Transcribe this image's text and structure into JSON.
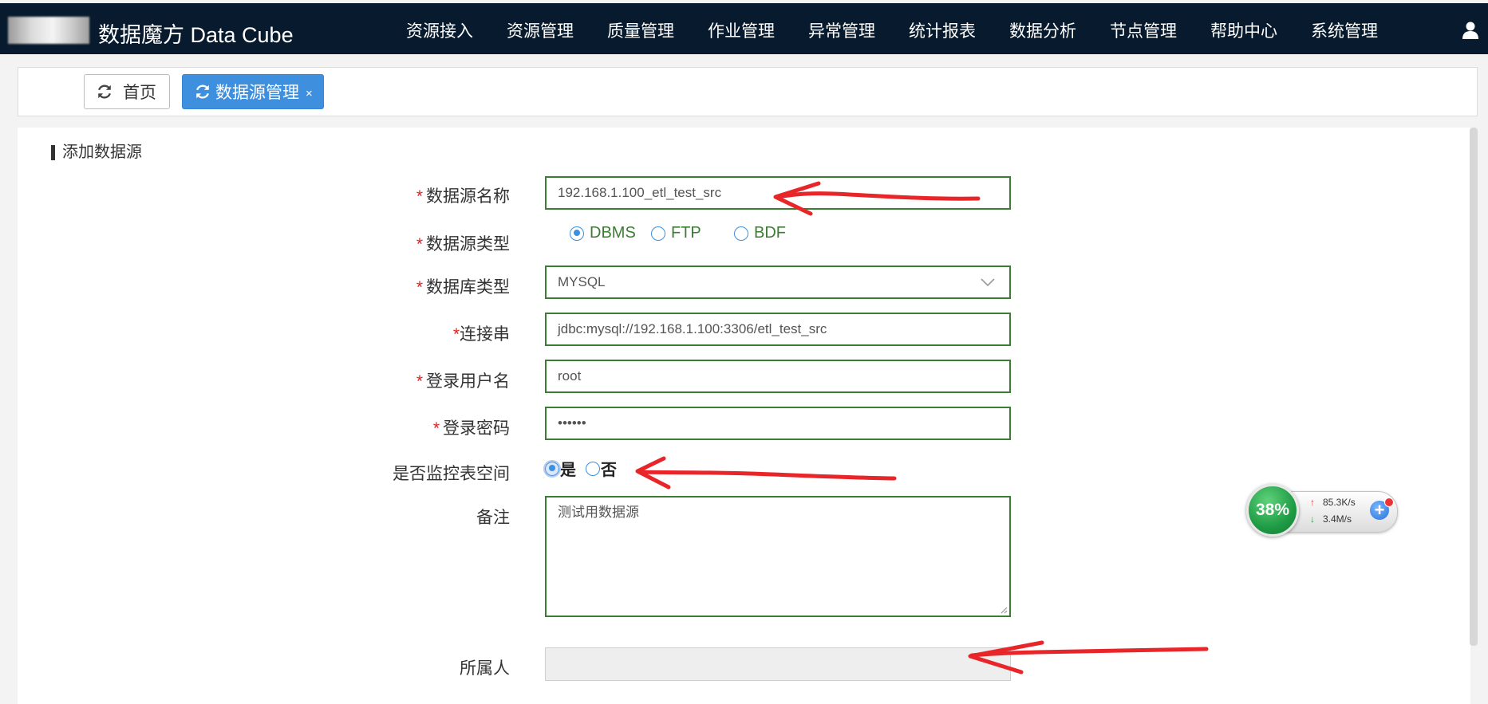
{
  "header": {
    "app_title": "数据魔方 Data Cube",
    "nav": [
      "资源接入",
      "资源管理",
      "质量管理",
      "作业管理",
      "异常管理",
      "统计报表",
      "数据分析",
      "节点管理",
      "帮助中心",
      "系统管理"
    ]
  },
  "tabs": {
    "home": "首页",
    "active": "数据源管理",
    "close": "×"
  },
  "form": {
    "section_title": "添加数据源",
    "required_mark": "*",
    "name": {
      "label": "数据源名称",
      "value": "192.168.1.100_etl_test_src"
    },
    "source_type": {
      "label": "数据源类型",
      "options": [
        "DBMS",
        "FTP",
        "BDF"
      ],
      "selected": "DBMS"
    },
    "db_type": {
      "label": "数据库类型",
      "value": "MYSQL"
    },
    "conn": {
      "label": "连接串",
      "value": "jdbc:mysql://192.168.1.100:3306/etl_test_src"
    },
    "username": {
      "label": "登录用户名",
      "value": "root"
    },
    "password": {
      "label": "登录密码",
      "value": "••••••"
    },
    "monitor": {
      "label": "是否监控表空间",
      "yes": "是",
      "no": "否",
      "selected": "是"
    },
    "remark": {
      "label": "备注",
      "value": "测试用数据源"
    },
    "owner": {
      "label": "所属人",
      "value": ""
    }
  },
  "speed_widget": {
    "percent": "38%",
    "upload": "85.3K/s",
    "download": "3.4M/s"
  },
  "colors": {
    "topbar": "#081b2e",
    "tab_active": "#3e8fde",
    "field_border": "#3b7d32",
    "annotation": "#e8262a"
  }
}
